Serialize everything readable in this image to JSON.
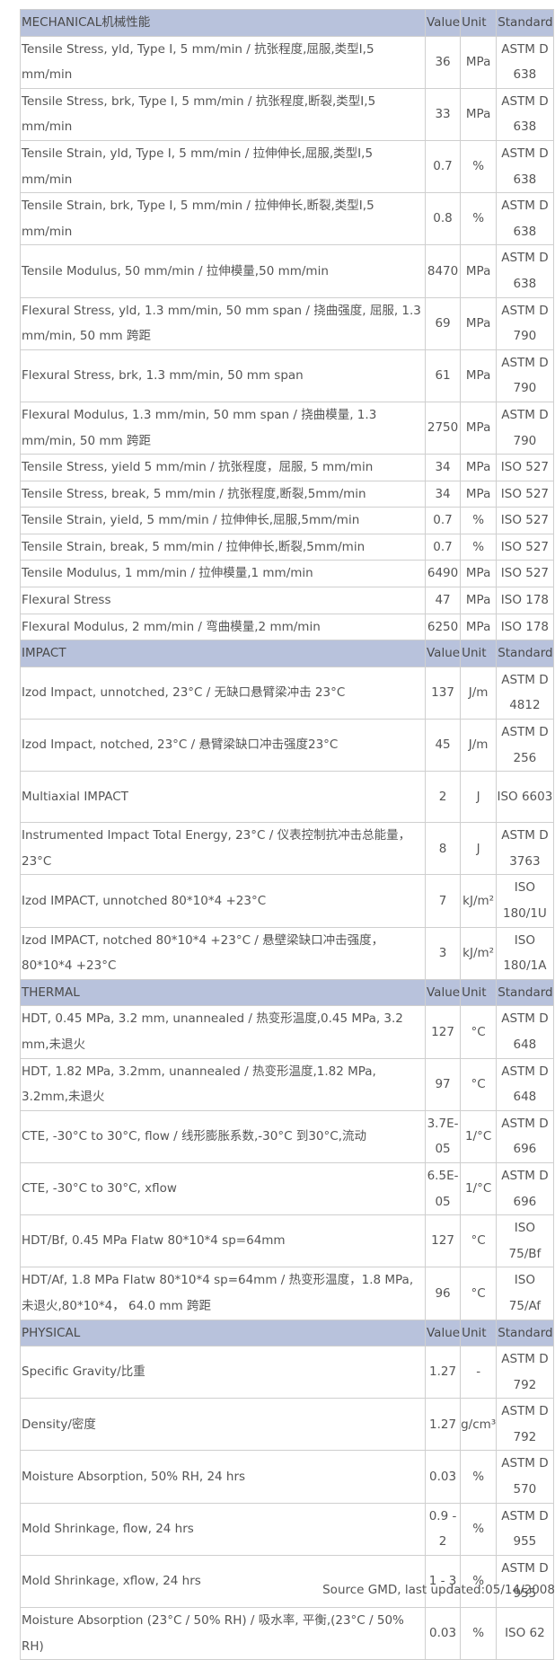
{
  "sections": [
    {
      "title": "MECHANICAL机械性能",
      "headers": [
        "Value",
        "Unit",
        "Standard"
      ],
      "rows": [
        {
          "name": "Tensile Stress, yld, Type I, 5 mm/min / 抗张程度,屈服,类型I,5 mm/min",
          "value": "36",
          "unit": "MPa",
          "std": "ASTM D 638"
        },
        {
          "name": "Tensile Stress, brk, Type I, 5 mm/min / 抗张程度,断裂,类型I,5 mm/min",
          "value": "33",
          "unit": "MPa",
          "std": "ASTM D 638"
        },
        {
          "name": "Tensile Strain, yld, Type I, 5 mm/min / 拉伸伸长,屈服,类型I,5 mm/min",
          "value": "0.7",
          "unit": "%",
          "std": "ASTM D 638"
        },
        {
          "name": "Tensile Strain, brk, Type I, 5 mm/min / 拉伸伸长,断裂,类型I,5 mm/min",
          "value": "0.8",
          "unit": "%",
          "std": "ASTM D 638"
        },
        {
          "name": "Tensile Modulus, 50 mm/min / 拉伸模量,50 mm/min",
          "value": "8470",
          "unit": "MPa",
          "std": "ASTM D 638",
          "tall": true
        },
        {
          "name": "Flexural Stress, yld, 1.3 mm/min, 50 mm span / 挠曲强度, 屈服, 1.3 mm/min, 50 mm 跨距",
          "value": "69",
          "unit": "MPa",
          "std": "ASTM D 790"
        },
        {
          "name": "Flexural Stress, brk, 1.3 mm/min, 50 mm span",
          "value": "61",
          "unit": "MPa",
          "std": "ASTM D 790",
          "tall": true
        },
        {
          "name": "Flexural Modulus, 1.3 mm/min, 50 mm span / 挠曲模量, 1.3 mm/min, 50 mm 跨距",
          "value": "2750",
          "unit": "MPa",
          "std": "ASTM D 790"
        },
        {
          "name": "Tensile Stress, yield 5 mm/min / 抗张程度，屈服, 5 mm/min",
          "value": "34",
          "unit": "MPa",
          "std": "ISO 527"
        },
        {
          "name": "Tensile Stress, break, 5 mm/min / 抗张程度,断裂,5mm/min",
          "value": "34",
          "unit": "MPa",
          "std": "ISO 527"
        },
        {
          "name": "Tensile Strain, yield, 5 mm/min / 拉伸伸长,屈服,5mm/min",
          "value": "0.7",
          "unit": "%",
          "std": "ISO 527"
        },
        {
          "name": "Tensile Strain, break, 5 mm/min / 拉伸伸长,断裂,5mm/min",
          "value": "0.7",
          "unit": "%",
          "std": "ISO 527"
        },
        {
          "name": "Tensile Modulus, 1 mm/min / 拉伸模量,1 mm/min",
          "value": "6490",
          "unit": "MPa",
          "std": "ISO 527"
        },
        {
          "name": "Flexural Stress",
          "value": "47",
          "unit": "MPa",
          "std": "ISO 178"
        },
        {
          "name": "Flexural Modulus, 2 mm/min / 弯曲模量,2 mm/min",
          "value": "6250",
          "unit": "MPa",
          "std": "ISO 178"
        }
      ]
    },
    {
      "title": "IMPACT",
      "headers": [
        "Value",
        "Unit",
        "Standard"
      ],
      "rows": [
        {
          "name": "Izod Impact, unnotched, 23°C / 无缺口悬臂梁冲击 23°C",
          "value": "137",
          "unit": "J/m",
          "std": "ASTM D 4812",
          "tall": true
        },
        {
          "name": "Izod Impact, notched, 23°C / 悬臂梁缺口冲击强度23°C",
          "value": "45",
          "unit": "J/m",
          "std": "ASTM D 256",
          "tall": true
        },
        {
          "name": "Multiaxial IMPACT",
          "value": "2",
          "unit": "J",
          "std": "ISO 6603"
        },
        {
          "name": "Instrumented Impact Total Energy, 23°C / 仪表控制抗冲击总能量，23°C",
          "value": "8",
          "unit": "J",
          "std": "ASTM D 3763"
        },
        {
          "name": "Izod IMPACT, unnotched 80*10*4 +23°C",
          "value": "7",
          "unit": "kJ/m²",
          "std": "ISO 180/1U",
          "tall": true
        },
        {
          "name": "Izod IMPACT, notched 80*10*4 +23°C / 悬壁梁缺口冲击强度，80*10*4 +23°C",
          "value": "3",
          "unit": "kJ/m²",
          "std": "ISO 180/1A"
        }
      ]
    },
    {
      "title": "THERMAL",
      "headers": [
        "Value",
        "Unit",
        "Standard"
      ],
      "rows": [
        {
          "name": "HDT, 0.45 MPa, 3.2 mm, unannealed / 热变形温度,0.45 MPa, 3.2 mm,未退火",
          "value": "127",
          "unit": "°C",
          "std": "ASTM D 648"
        },
        {
          "name": "HDT, 1.82 MPa, 3.2mm, unannealed / 热变形温度,1.82 MPa, 3.2mm,未退火",
          "value": "97",
          "unit": "°C",
          "std": "ASTM D 648"
        },
        {
          "name": "CTE, -30°C to 30°C, flow / 线形膨胀系数,-30°C 到30°C,流动",
          "value": "3.7E-05",
          "unit": "1/°C",
          "std": "ASTM D 696",
          "tall": true
        },
        {
          "name": "CTE, -30°C to 30°C, xflow",
          "value": "6.5E-05",
          "unit": "1/°C",
          "std": "ASTM D 696",
          "tall": true
        },
        {
          "name": "HDT/Bf, 0.45 MPa Flatw 80*10*4 sp=64mm",
          "value": "127",
          "unit": "°C",
          "std": "ISO 75/Bf"
        },
        {
          "name": "HDT/Af, 1.8 MPa Flatw 80*10*4 sp=64mm / 热变形温度，1.8 MPa, 未退火,80*10*4， 64.0 mm 跨距",
          "value": "96",
          "unit": "°C",
          "std": "ISO 75/Af"
        }
      ]
    },
    {
      "title": "PHYSICAL",
      "headers": [
        "Value",
        "Unit",
        "Standard"
      ],
      "rows": [
        {
          "name": "Specific Gravity/比重",
          "value": "1.27",
          "unit": "-",
          "std": "ASTM D 792",
          "tall": true
        },
        {
          "name": "Density/密度",
          "value": "1.27",
          "unit": "g/cm³",
          "std": "ASTM D 792",
          "tall": true
        },
        {
          "name": "Moisture Absorption, 50% RH, 24 hrs",
          "value": "0.03",
          "unit": "%",
          "std": "ASTM D 570",
          "tall": true
        },
        {
          "name": "Mold Shrinkage, flow, 24 hrs",
          "value": "0.9 - 2",
          "unit": "%",
          "std": "ASTM D 955",
          "tall": true
        },
        {
          "name": "Mold Shrinkage, xflow, 24 hrs",
          "value": "1 - 3",
          "unit": "%",
          "std": "ASTM D 955",
          "tall": true
        },
        {
          "name": "Moisture Absorption (23°C / 50% RH) / 吸水率, 平衡,(23°C / 50% RH)",
          "value": "0.03",
          "unit": "%",
          "std": "ISO 62"
        }
      ]
    }
  ],
  "footer": "Source GMD, last updated:05/14/2008"
}
